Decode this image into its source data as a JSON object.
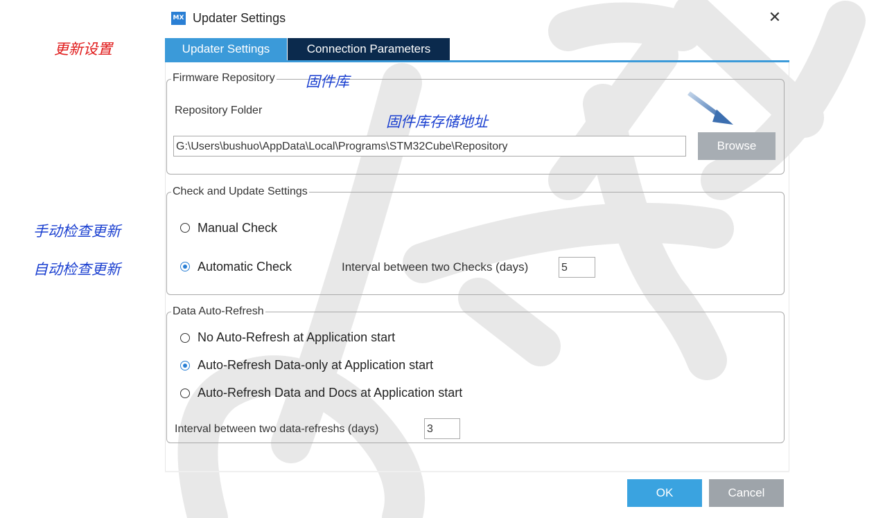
{
  "window": {
    "logo_text": "MX",
    "title": "Updater Settings",
    "close_glyph": "✕"
  },
  "tabs": [
    {
      "label": "Updater Settings",
      "active": true
    },
    {
      "label": "Connection Parameters",
      "active": false
    }
  ],
  "firmware_repository": {
    "group_title": "Firmware Repository",
    "folder_label": "Repository Folder",
    "folder_value": "G:\\Users\\bushuo\\AppData\\Local\\Programs\\STM32Cube\\Repository",
    "browse_label": "Browse"
  },
  "check_update": {
    "group_title": "Check and Update Settings",
    "manual_label": "Manual Check",
    "automatic_label": "Automatic Check",
    "selected": "automatic",
    "interval_label": "Interval between two Checks (days)",
    "interval_value": "5"
  },
  "auto_refresh": {
    "group_title": "Data Auto-Refresh",
    "options": [
      {
        "label": "No Auto-Refresh at Application start",
        "checked": false
      },
      {
        "label": "Auto-Refresh Data-only at Application start",
        "checked": true
      },
      {
        "label": "Auto-Refresh Data and Docs at Application start",
        "checked": false
      }
    ],
    "interval_label": "Interval between two data-refreshs (days)",
    "interval_value": "3"
  },
  "footer": {
    "ok_label": "OK",
    "cancel_label": "Cancel"
  },
  "annotations": {
    "tab_note": "更新设置",
    "repo_note": "固件库",
    "folder_note": "固件库存储地址",
    "manual_note": "手动检查更新",
    "auto_note": "自动检查更新"
  },
  "colors": {
    "accent": "#3b9ad9",
    "tab_dark": "#0b2a4d",
    "annotation_blue": "#1a3fd0",
    "annotation_red": "#e01818"
  }
}
